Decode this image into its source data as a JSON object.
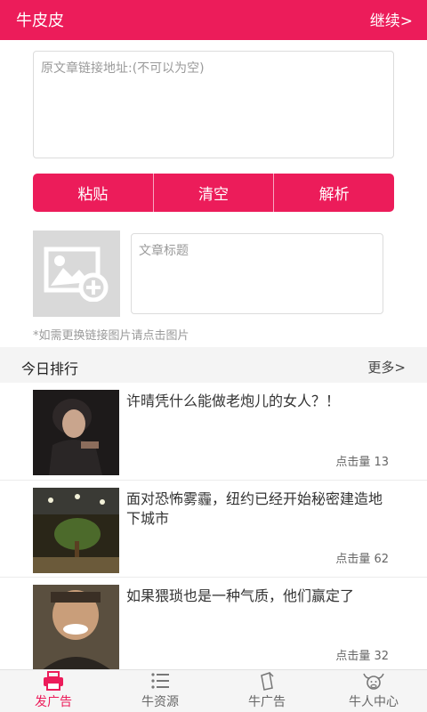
{
  "header": {
    "title": "牛皮皮",
    "next": "继续>"
  },
  "url_input": {
    "placeholder": "原文章链接地址:(不可以为空)",
    "value": ""
  },
  "actions": {
    "paste": "粘贴",
    "clear": "清空",
    "parse": "解析"
  },
  "article": {
    "title_placeholder": "文章标题",
    "hint": "*如需更换链接图片请点击图片"
  },
  "ranking": {
    "label": "今日排行",
    "more": "更多>",
    "items": [
      {
        "title": "许晴凭什么能做老炮儿的女人？！",
        "views": "点击量 13"
      },
      {
        "title": "面对恐怖雾霾，纽约已经开始秘密建造地下城市",
        "views": "点击量 62"
      },
      {
        "title": "如果猥琐也是一种气质，他们赢定了",
        "views": "点击量 32"
      }
    ]
  },
  "tabs": [
    {
      "label": "发广告",
      "icon": "printer-icon",
      "active": true
    },
    {
      "label": "牛资源",
      "icon": "list-icon",
      "active": false
    },
    {
      "label": "牛广告",
      "icon": "document-icon",
      "active": false
    },
    {
      "label": "牛人中心",
      "icon": "ox-head-icon",
      "active": false
    }
  ],
  "colors": {
    "accent": "#ec1c5a"
  }
}
